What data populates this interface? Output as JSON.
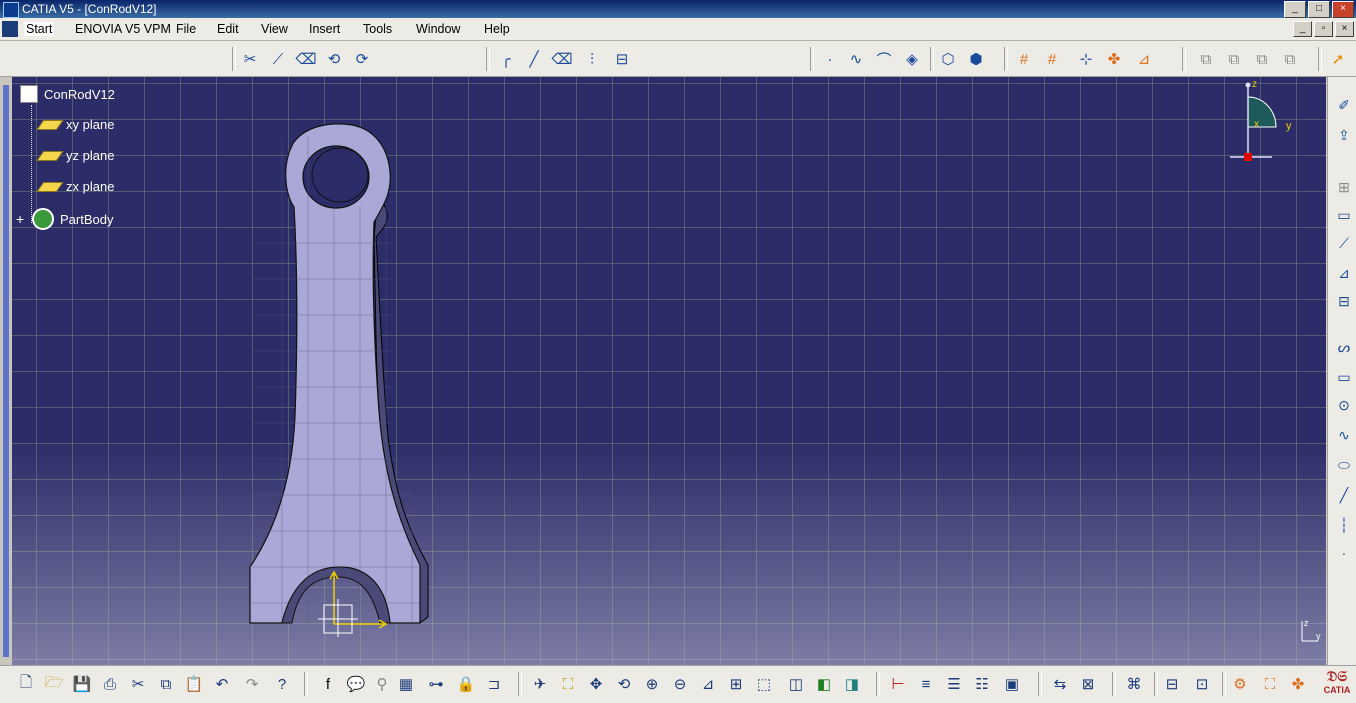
{
  "window": {
    "title": "CATIA V5 - [ConRodV12]"
  },
  "menu": [
    {
      "label": "Start"
    },
    {
      "label": "ENOVIA V5 VPM"
    },
    {
      "label": "File"
    },
    {
      "label": "Edit"
    },
    {
      "label": "View"
    },
    {
      "label": "Insert"
    },
    {
      "label": "Tools"
    },
    {
      "label": "Window"
    },
    {
      "label": "Help"
    }
  ],
  "tree": {
    "root": "ConRodV12",
    "planes": [
      "xy plane",
      "yz plane",
      "zx plane"
    ],
    "body": "PartBody"
  },
  "compass": {
    "x": "x",
    "y": "y",
    "z": "z"
  },
  "corner_axis": {
    "z": "z",
    "y": "y"
  },
  "brand": {
    "label": "CATIA"
  },
  "colors": {
    "viewport_top": "#2c2c68",
    "part_fill": "#a9a8d6",
    "accent_yellow": "#f0d000"
  },
  "icons": {
    "top_toolbar": [
      "cut-icon",
      "trim-icon",
      "eraser-icon",
      "constraint-icon",
      "auto-constraint-icon",
      "corner-icon",
      "chamfer-icon",
      "eraser-2-icon",
      "mirror-icon",
      "project-icon",
      "point-icon",
      "spline-icon",
      "arc-icon",
      "pad-sketch-icon",
      "sketch-icon",
      "exit-sketch-icon",
      "grid-icon",
      "snap-icon",
      "construction-icon",
      "geometry-icon",
      "dimension-icon",
      "analysis-icon",
      "part-icon",
      "product-icon",
      "assembly-icon",
      "drawing-icon",
      "select-arrow-icon"
    ],
    "right_toolbar": [
      "sketcher-icon",
      "exit-icon",
      "profile-icon",
      "rectangle-icon",
      "circle-icon",
      "spline-icon",
      "ellipse-icon",
      "line-icon",
      "axis-icon",
      "point-icon"
    ],
    "bottom_toolbar": [
      "new-icon",
      "open-icon",
      "save-icon",
      "print-icon",
      "cut-icon",
      "copy-icon",
      "paste-icon",
      "undo-icon",
      "redo-icon",
      "help-icon",
      "formula-icon",
      "comment-icon",
      "knowledge-icon",
      "table-icon",
      "tree-icon",
      "lock-icon",
      "publish-icon",
      "fly-icon",
      "fit-all-icon",
      "pan-icon",
      "rotate-icon",
      "zoom-in-icon",
      "zoom-out-icon",
      "normal-view-icon",
      "multi-view-icon",
      "iso-view-icon",
      "hide-show-icon",
      "swap-icon",
      "render-icon",
      "measure-icon",
      "measure-item-icon",
      "properties-icon",
      "parameters-icon",
      "catalog-icon",
      "align-icon",
      "clash-icon",
      "section-icon",
      "annotation-icon",
      "capture-icon",
      "orange-tool-icon",
      "orange-tool-2-icon",
      "orange-tool-3-icon"
    ]
  }
}
